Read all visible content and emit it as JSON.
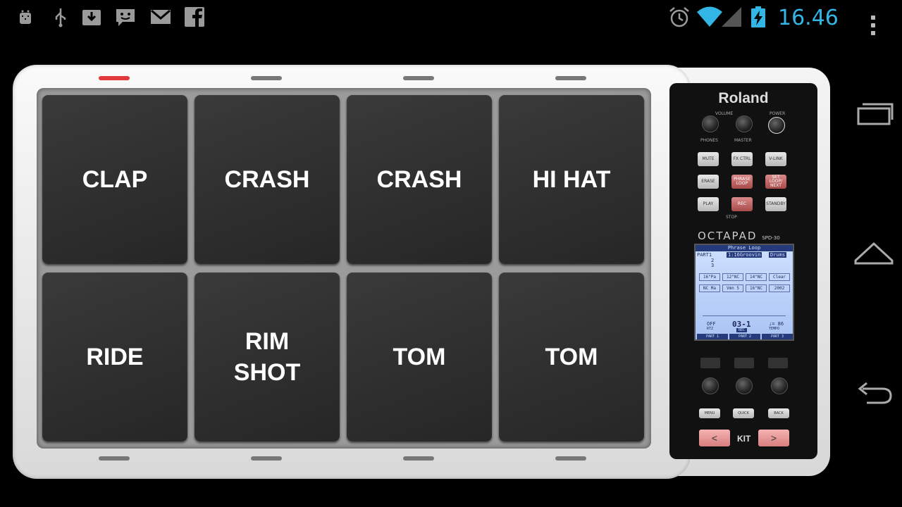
{
  "status_bar": {
    "time": "16.46",
    "left_icons": [
      "android-debug-icon",
      "usb-icon",
      "download-icon",
      "chat-icon",
      "gmail-icon",
      "facebook-icon"
    ],
    "right_icons": [
      "alarm-icon",
      "wifi-icon",
      "signal-icon",
      "battery-charging-icon"
    ],
    "time_color": "#33b5e5"
  },
  "pads": [
    {
      "label": "CLAP"
    },
    {
      "label": "CRASH"
    },
    {
      "label": "CRASH"
    },
    {
      "label": "HI HAT"
    },
    {
      "label": "RIDE"
    },
    {
      "label": "RIM\nSHOT"
    },
    {
      "label": "TOM"
    },
    {
      "label": "TOM"
    }
  ],
  "device": {
    "brand": "Roland",
    "model": "OCTAPAD",
    "model_sub": "SPD-30",
    "labels": {
      "volume": "VOLUME",
      "power": "POWER",
      "phones": "PHONES",
      "master": "MASTER",
      "stop": "STOP",
      "kit": "KIT"
    },
    "buttons": {
      "mute": "MUTE",
      "fx_ctrl": "FX CTRL",
      "v_link": "V-LINK",
      "erase": "ERASE",
      "phrase_loop": "PHRASE LOOP",
      "set_loop": "SET LOOP/ NEXT",
      "play": "PLAY",
      "rec": "REC",
      "standby": "STANDBY",
      "menu": "MENU",
      "quick": "QUICK",
      "back": "BACK",
      "kit_prev": "<",
      "kit_next": ">"
    },
    "lcd": {
      "title": "Phrase Loop",
      "part_label": "PART1",
      "part_rows": [
        "2",
        "3"
      ],
      "header_cells": [
        "1:16Groovin",
        "Drums"
      ],
      "cells": [
        "16\"Pa",
        "12\"NC",
        "14\"NC",
        "Clear",
        "NC Ma",
        "Vmn 5",
        "16\"NC",
        "2002"
      ],
      "off": "OFF",
      "rtz": "RTZ",
      "measure": "03-1",
      "rec": "REC",
      "tempo_value": "♩= 86",
      "tempo_label": "TEMPO",
      "parts": [
        "PART 1",
        "PART 2",
        "PART 3"
      ]
    }
  }
}
